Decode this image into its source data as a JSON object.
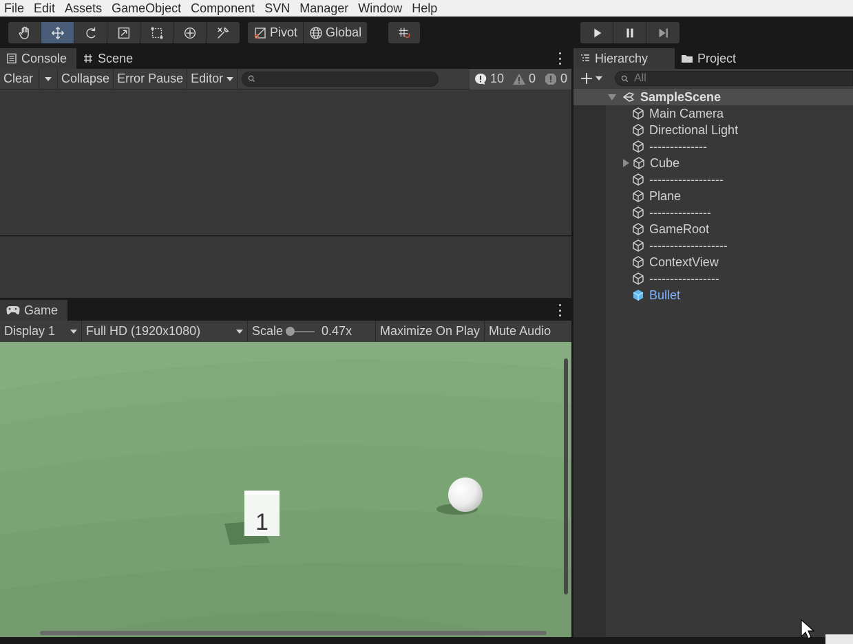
{
  "menu": [
    "File",
    "Edit",
    "Assets",
    "GameObject",
    "Component",
    "SVN",
    "Manager",
    "Window",
    "Help"
  ],
  "toolbar": {
    "pivot_label": "Pivot",
    "global_label": "Global"
  },
  "console_tabs": {
    "console": "Console",
    "scene": "Scene"
  },
  "console_bar": {
    "clear": "Clear",
    "collapse": "Collapse",
    "error_pause": "Error Pause",
    "editor": "Editor",
    "search_value": "",
    "info_count": "10",
    "warning_count": "0",
    "error_count": "0"
  },
  "game_tab": {
    "label": "Game"
  },
  "game_bar": {
    "display": "Display 1",
    "resolution": "Full HD (1920x1080)",
    "scale_label": "Scale",
    "scale_value": "0.47x",
    "maximize": "Maximize On Play",
    "mute": "Mute Audio"
  },
  "game_view": {
    "cube_number": "1"
  },
  "hierarchy_tabs": {
    "hierarchy": "Hierarchy",
    "project": "Project"
  },
  "hierarchy": {
    "search_placeholder": "All",
    "scene_name": "SampleScene",
    "items": [
      {
        "label": "Main Camera"
      },
      {
        "label": "Directional Light"
      },
      {
        "label": "--------------"
      },
      {
        "label": "Cube"
      },
      {
        "label": "------------------"
      },
      {
        "label": "Plane"
      },
      {
        "label": "---------------"
      },
      {
        "label": "GameRoot"
      },
      {
        "label": "-------------------"
      },
      {
        "label": "ContextView"
      },
      {
        "label": "-----------------"
      },
      {
        "label": "Bullet"
      }
    ]
  },
  "colors": {
    "active_tool": "#4a5d78",
    "game_background": "#80a779",
    "selected_item": "#7fb3ff"
  }
}
